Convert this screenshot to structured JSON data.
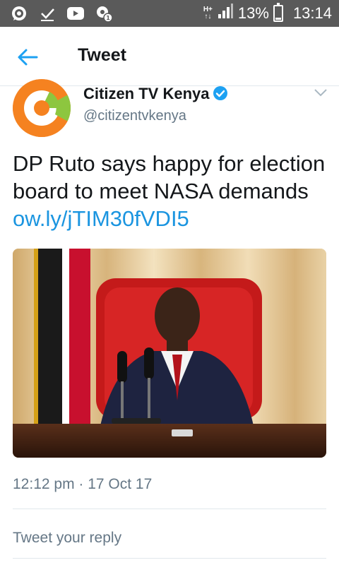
{
  "status_bar": {
    "network_type_top": "H+",
    "network_type_bottom": "↑↓",
    "battery_percent": "13%",
    "battery_level": 0.13,
    "time": "13:14",
    "left_icons": [
      "whatsapp-icon",
      "download-done-icon",
      "youtube-icon",
      "settings-badge-icon"
    ]
  },
  "app_bar": {
    "title": "Tweet"
  },
  "tweet": {
    "author_name": "Citizen TV Kenya",
    "author_handle": "@citizentvkenya",
    "verified": true,
    "text_plain": "DP Ruto says happy for election board to meet NASA demands ",
    "text_link": "ow.ly/jTIM30fVDI5",
    "timestamp": "12:12 pm · 17 Oct 17"
  },
  "reply": {
    "placeholder": "Tweet your reply"
  },
  "colors": {
    "status_bar_bg": "#5a5a5a",
    "link_blue": "#1b95e0",
    "verified_blue": "#1da1f2",
    "text_dark": "#14171a",
    "text_muted": "#657786",
    "avatar_orange": "#f58220",
    "avatar_green": "#8dc63f"
  }
}
